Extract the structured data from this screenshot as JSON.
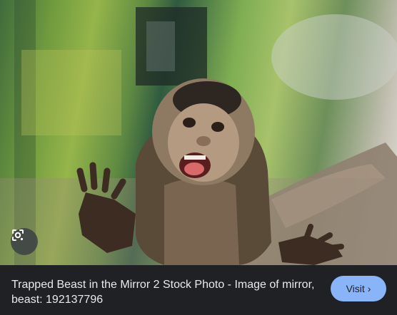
{
  "image": {
    "alt": "Trapped Beast in the Mirror 2 Stock Photo - Image of mirror, beast: 192137796",
    "lens_icon": "google-lens-icon"
  },
  "caption": {
    "title": "Trapped Beast in the Mirror 2 Stock Photo - Image of mirror, beast: 192137796"
  },
  "visit_button": {
    "label": "Visit",
    "icon": "chevron-right-icon"
  },
  "colors": {
    "background": "#202124",
    "visit_button": "#8ab4f8",
    "caption_text": "#e8eaed"
  }
}
